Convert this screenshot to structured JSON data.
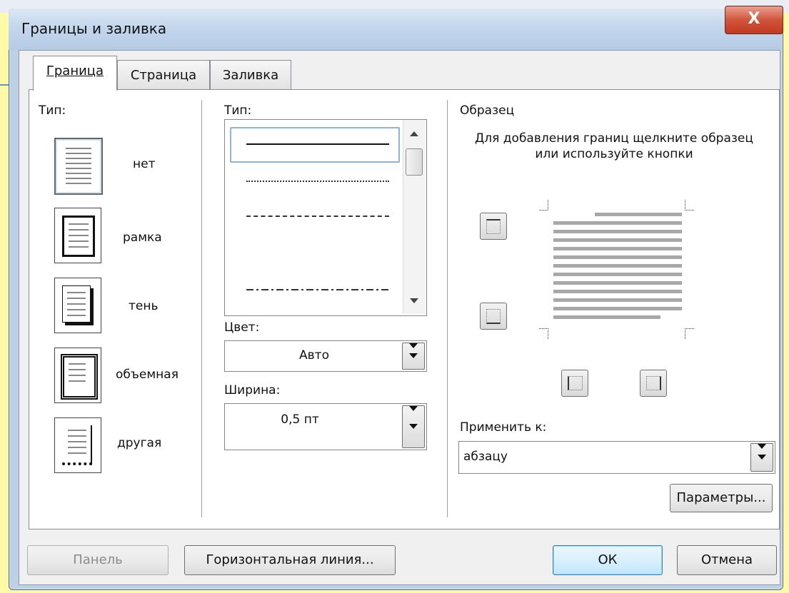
{
  "window": {
    "title": "Границы и заливка",
    "close_label": "X"
  },
  "tabs": [
    {
      "label": "Граница",
      "active": true
    },
    {
      "label": "Страница",
      "active": false
    },
    {
      "label": "Заливка",
      "active": false
    }
  ],
  "setting": {
    "label": "Тип:",
    "presets": [
      {
        "label": "нет",
        "icon": "none-border-icon",
        "selected": true
      },
      {
        "label": "рамка",
        "icon": "box-border-icon",
        "selected": false
      },
      {
        "label": "тень",
        "icon": "shadow-border-icon",
        "selected": false
      },
      {
        "label": "объемная",
        "icon": "3d-border-icon",
        "selected": false
      },
      {
        "label": "другая",
        "icon": "custom-border-icon",
        "selected": false
      }
    ]
  },
  "style": {
    "label": "Тип:",
    "line_styles": [
      "solid",
      "dotted",
      "dashed-small",
      "dashed",
      "dash-dot"
    ],
    "selected_style": "solid",
    "color_label": "Цвет:",
    "color_value": "Авто",
    "width_label": "Ширина:",
    "width_value": "0,5 пт"
  },
  "preview": {
    "label": "Образец",
    "hint": "Для добавления границ щелкните образец или используйте кнопки",
    "apply_label": "Применить к:",
    "apply_value": "абзацу",
    "options_button": "Параметры..."
  },
  "footer": {
    "toolbar_button": "Панель",
    "hline_button": "Горизонтальная линия...",
    "ok_button": "ОК",
    "cancel_button": "Отмена"
  }
}
